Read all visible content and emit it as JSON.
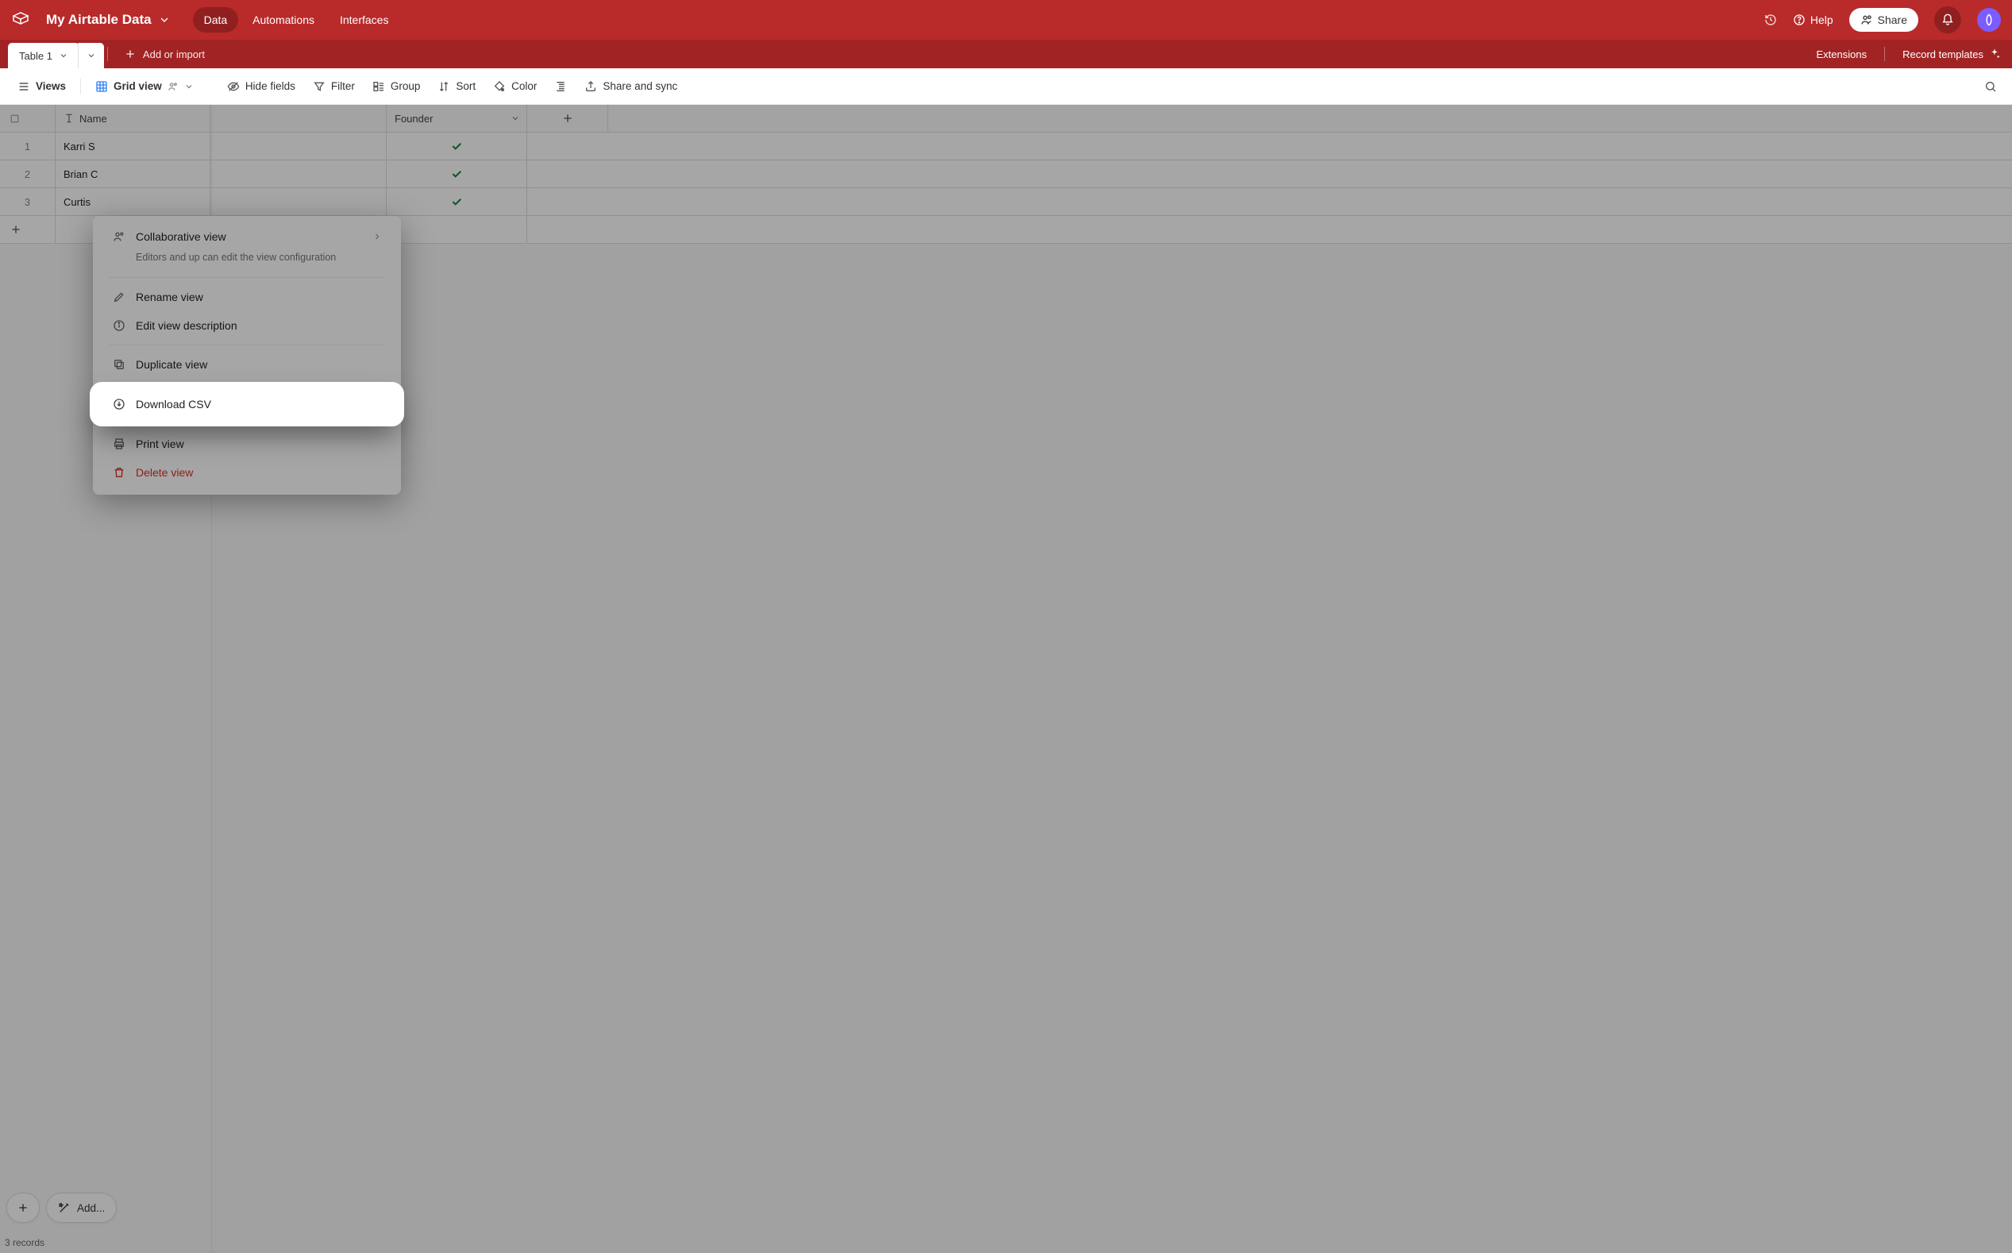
{
  "colors": {
    "brand": "#b92a2a",
    "check": "#1a7f37",
    "danger": "#d93025",
    "blue": "#2d7ff9"
  },
  "topbar": {
    "base_name": "My Airtable Data",
    "tabs": {
      "data": "Data",
      "automations": "Automations",
      "interfaces": "Interfaces"
    },
    "help": "Help",
    "share": "Share"
  },
  "tablesbar": {
    "active_table": "Table 1",
    "add_or_import": "Add or import",
    "extensions": "Extensions",
    "record_templates": "Record templates"
  },
  "toolbar": {
    "views": "Views",
    "grid_view": "Grid view",
    "hide_fields": "Hide fields",
    "filter": "Filter",
    "group": "Group",
    "sort": "Sort",
    "color": "Color",
    "share_sync": "Share and sync"
  },
  "grid": {
    "columns": {
      "name": "Name",
      "founder": "Founder"
    },
    "rows": [
      {
        "num": "1",
        "name": "Karri S",
        "founder": true
      },
      {
        "num": "2",
        "name": "Brian C",
        "founder": true
      },
      {
        "num": "3",
        "name": "Curtis",
        "founder": true
      }
    ]
  },
  "bottom": {
    "add": "Add...",
    "status": "3 records"
  },
  "context_menu": {
    "collaborative": "Collaborative view",
    "collaborative_sub": "Editors and up can edit the view configuration",
    "rename": "Rename view",
    "edit_desc": "Edit view description",
    "duplicate": "Duplicate view",
    "download_csv": "Download CSV",
    "print": "Print view",
    "delete": "Delete view"
  }
}
